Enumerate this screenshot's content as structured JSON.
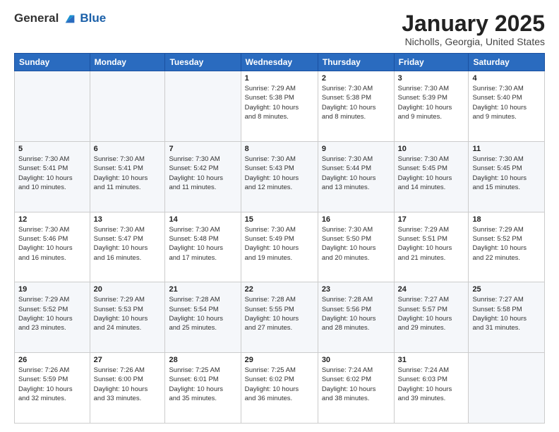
{
  "header": {
    "logo_general": "General",
    "logo_blue": "Blue",
    "title": "January 2025",
    "subtitle": "Nicholls, Georgia, United States"
  },
  "days_of_week": [
    "Sunday",
    "Monday",
    "Tuesday",
    "Wednesday",
    "Thursday",
    "Friday",
    "Saturday"
  ],
  "weeks": [
    [
      {
        "day": "",
        "info": ""
      },
      {
        "day": "",
        "info": ""
      },
      {
        "day": "",
        "info": ""
      },
      {
        "day": "1",
        "info": "Sunrise: 7:29 AM\nSunset: 5:38 PM\nDaylight: 10 hours\nand 8 minutes."
      },
      {
        "day": "2",
        "info": "Sunrise: 7:30 AM\nSunset: 5:38 PM\nDaylight: 10 hours\nand 8 minutes."
      },
      {
        "day": "3",
        "info": "Sunrise: 7:30 AM\nSunset: 5:39 PM\nDaylight: 10 hours\nand 9 minutes."
      },
      {
        "day": "4",
        "info": "Sunrise: 7:30 AM\nSunset: 5:40 PM\nDaylight: 10 hours\nand 9 minutes."
      }
    ],
    [
      {
        "day": "5",
        "info": "Sunrise: 7:30 AM\nSunset: 5:41 PM\nDaylight: 10 hours\nand 10 minutes."
      },
      {
        "day": "6",
        "info": "Sunrise: 7:30 AM\nSunset: 5:41 PM\nDaylight: 10 hours\nand 11 minutes."
      },
      {
        "day": "7",
        "info": "Sunrise: 7:30 AM\nSunset: 5:42 PM\nDaylight: 10 hours\nand 11 minutes."
      },
      {
        "day": "8",
        "info": "Sunrise: 7:30 AM\nSunset: 5:43 PM\nDaylight: 10 hours\nand 12 minutes."
      },
      {
        "day": "9",
        "info": "Sunrise: 7:30 AM\nSunset: 5:44 PM\nDaylight: 10 hours\nand 13 minutes."
      },
      {
        "day": "10",
        "info": "Sunrise: 7:30 AM\nSunset: 5:45 PM\nDaylight: 10 hours\nand 14 minutes."
      },
      {
        "day": "11",
        "info": "Sunrise: 7:30 AM\nSunset: 5:45 PM\nDaylight: 10 hours\nand 15 minutes."
      }
    ],
    [
      {
        "day": "12",
        "info": "Sunrise: 7:30 AM\nSunset: 5:46 PM\nDaylight: 10 hours\nand 16 minutes."
      },
      {
        "day": "13",
        "info": "Sunrise: 7:30 AM\nSunset: 5:47 PM\nDaylight: 10 hours\nand 16 minutes."
      },
      {
        "day": "14",
        "info": "Sunrise: 7:30 AM\nSunset: 5:48 PM\nDaylight: 10 hours\nand 17 minutes."
      },
      {
        "day": "15",
        "info": "Sunrise: 7:30 AM\nSunset: 5:49 PM\nDaylight: 10 hours\nand 19 minutes."
      },
      {
        "day": "16",
        "info": "Sunrise: 7:30 AM\nSunset: 5:50 PM\nDaylight: 10 hours\nand 20 minutes."
      },
      {
        "day": "17",
        "info": "Sunrise: 7:29 AM\nSunset: 5:51 PM\nDaylight: 10 hours\nand 21 minutes."
      },
      {
        "day": "18",
        "info": "Sunrise: 7:29 AM\nSunset: 5:52 PM\nDaylight: 10 hours\nand 22 minutes."
      }
    ],
    [
      {
        "day": "19",
        "info": "Sunrise: 7:29 AM\nSunset: 5:52 PM\nDaylight: 10 hours\nand 23 minutes."
      },
      {
        "day": "20",
        "info": "Sunrise: 7:29 AM\nSunset: 5:53 PM\nDaylight: 10 hours\nand 24 minutes."
      },
      {
        "day": "21",
        "info": "Sunrise: 7:28 AM\nSunset: 5:54 PM\nDaylight: 10 hours\nand 25 minutes."
      },
      {
        "day": "22",
        "info": "Sunrise: 7:28 AM\nSunset: 5:55 PM\nDaylight: 10 hours\nand 27 minutes."
      },
      {
        "day": "23",
        "info": "Sunrise: 7:28 AM\nSunset: 5:56 PM\nDaylight: 10 hours\nand 28 minutes."
      },
      {
        "day": "24",
        "info": "Sunrise: 7:27 AM\nSunset: 5:57 PM\nDaylight: 10 hours\nand 29 minutes."
      },
      {
        "day": "25",
        "info": "Sunrise: 7:27 AM\nSunset: 5:58 PM\nDaylight: 10 hours\nand 31 minutes."
      }
    ],
    [
      {
        "day": "26",
        "info": "Sunrise: 7:26 AM\nSunset: 5:59 PM\nDaylight: 10 hours\nand 32 minutes."
      },
      {
        "day": "27",
        "info": "Sunrise: 7:26 AM\nSunset: 6:00 PM\nDaylight: 10 hours\nand 33 minutes."
      },
      {
        "day": "28",
        "info": "Sunrise: 7:25 AM\nSunset: 6:01 PM\nDaylight: 10 hours\nand 35 minutes."
      },
      {
        "day": "29",
        "info": "Sunrise: 7:25 AM\nSunset: 6:02 PM\nDaylight: 10 hours\nand 36 minutes."
      },
      {
        "day": "30",
        "info": "Sunrise: 7:24 AM\nSunset: 6:02 PM\nDaylight: 10 hours\nand 38 minutes."
      },
      {
        "day": "31",
        "info": "Sunrise: 7:24 AM\nSunset: 6:03 PM\nDaylight: 10 hours\nand 39 minutes."
      },
      {
        "day": "",
        "info": ""
      }
    ]
  ]
}
